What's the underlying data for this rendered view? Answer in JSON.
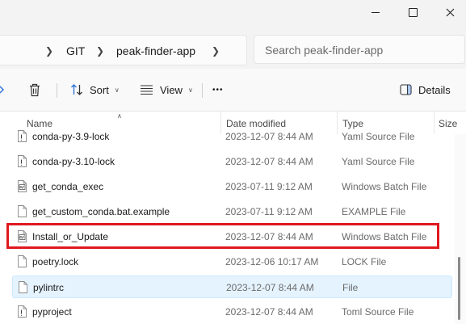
{
  "window": {
    "minimize_icon": "minimize-icon",
    "maximize_icon": "maximize-icon",
    "close_icon": "close-icon"
  },
  "breadcrumb": {
    "items": [
      "GIT",
      "peak-finder-app"
    ]
  },
  "search": {
    "placeholder": "Search peak-finder-app",
    "value": ""
  },
  "toolbar": {
    "sort_label": "Sort",
    "view_label": "View",
    "more_label": "•••",
    "details_label": "Details"
  },
  "columns": {
    "name": "Name",
    "date_modified": "Date modified",
    "type": "Type",
    "size": "Size"
  },
  "files": [
    {
      "name": "conda-py-3.9-lock",
      "date": "2023-12-07 8:44 AM",
      "type": "Yaml Source File",
      "icon": "yaml-file-icon"
    },
    {
      "name": "conda-py-3.10-lock",
      "date": "2023-12-07 8:44 AM",
      "type": "Yaml Source File",
      "icon": "yaml-file-icon"
    },
    {
      "name": "get_conda_exec",
      "date": "2023-07-11 9:12 AM",
      "type": "Windows Batch File",
      "icon": "batch-file-icon"
    },
    {
      "name": "get_custom_conda.bat.example",
      "date": "2023-07-11 9:12 AM",
      "type": "EXAMPLE File",
      "icon": "generic-file-icon"
    },
    {
      "name": "Install_or_Update",
      "date": "2023-12-07 8:44 AM",
      "type": "Windows Batch File",
      "icon": "batch-file-icon"
    },
    {
      "name": "poetry.lock",
      "date": "2023-12-06 10:17 AM",
      "type": "LOCK File",
      "icon": "generic-file-icon"
    },
    {
      "name": "pylintrc",
      "date": "2023-12-07 8:44 AM",
      "type": "File",
      "icon": "generic-file-icon"
    },
    {
      "name": "pyproject",
      "date": "2023-12-07 8:44 AM",
      "type": "Toml Source File",
      "icon": "toml-file-icon"
    }
  ],
  "selected_file": "pylintrc",
  "highlighted_file": "Install_or_Update",
  "colors": {
    "highlight_border": "#e0181f",
    "selection_background": "#e5f3ff",
    "chrome_background": "#f3f3f3"
  }
}
